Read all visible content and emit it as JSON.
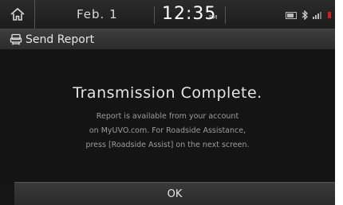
{
  "status_bar": {
    "home_icon": "home-icon",
    "date": "Feb. 1",
    "time": "12:35",
    "ampm": "PM",
    "icons": [
      "battery-icon",
      "bluetooth-icon",
      "signal-icon"
    ],
    "alert_color": "#d21c1c"
  },
  "title_bar": {
    "icon": "report-icon",
    "title": "Send Report"
  },
  "dialog": {
    "heading": "Transmission Complete.",
    "body_lines": [
      "Report is available from your account",
      "on MyUVO.com. For Roadside Assistance,",
      "press [Roadside Assist] on the next screen."
    ]
  },
  "ok_button": {
    "label": "OK"
  }
}
